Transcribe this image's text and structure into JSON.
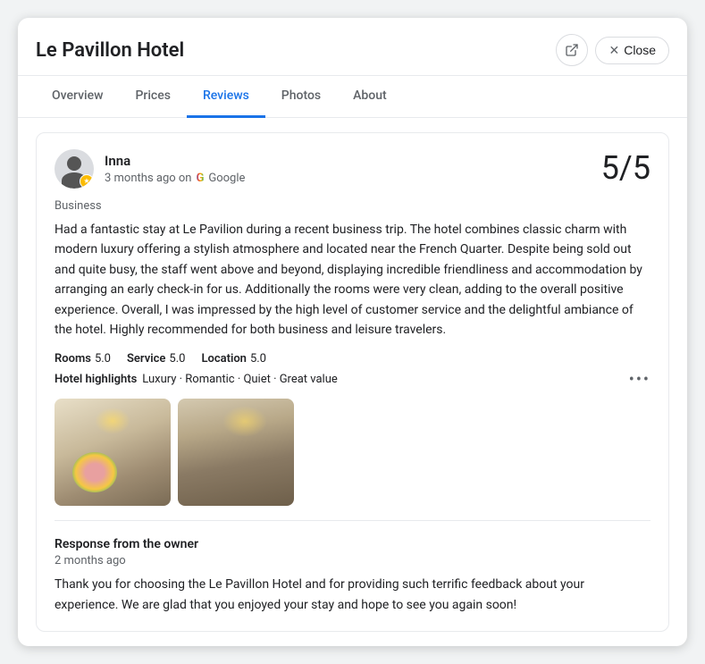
{
  "window": {
    "title": "Le Pavillon Hotel",
    "close_label": "Close"
  },
  "tabs": [
    {
      "id": "overview",
      "label": "Overview",
      "active": false
    },
    {
      "id": "prices",
      "label": "Prices",
      "active": false
    },
    {
      "id": "reviews",
      "label": "Reviews",
      "active": true
    },
    {
      "id": "photos",
      "label": "Photos",
      "active": false
    },
    {
      "id": "about",
      "label": "About",
      "active": false
    }
  ],
  "review": {
    "reviewer_name": "Inna",
    "reviewer_date": "3 months ago on",
    "google_label": "Google",
    "rating": "5/5",
    "category": "Business",
    "text": "Had a fantastic stay at Le Pavilion during a recent business trip. The hotel combines classic charm with modern luxury offering a stylish atmosphere and located near the French Quarter. Despite being sold out and quite busy, the staff went above and beyond, displaying incredible friendliness and accommodation by arranging an early check-in for us. Additionally the rooms were very clean, adding to the overall positive experience. Overall, I was impressed by the high level of customer service and the delightful ambiance of the hotel. Highly recommended for both business and leisure travelers.",
    "ratings": [
      {
        "label": "Rooms",
        "value": "5.0"
      },
      {
        "label": "Service",
        "value": "5.0"
      },
      {
        "label": "Location",
        "value": "5.0"
      }
    ],
    "highlights_label": "Hotel highlights",
    "highlights": "Luxury · Romantic · Quiet · Great value",
    "more_icon": "•••",
    "response": {
      "title": "Response from the owner",
      "date": "2 months ago",
      "text": "Thank you for choosing the Le Pavillon Hotel and for providing such terrific feedback about your experience. We are glad that you enjoyed your stay and hope to see you again soon!"
    }
  },
  "colors": {
    "active_tab": "#1a73e8",
    "text_primary": "#202124",
    "text_secondary": "#5f6368"
  }
}
